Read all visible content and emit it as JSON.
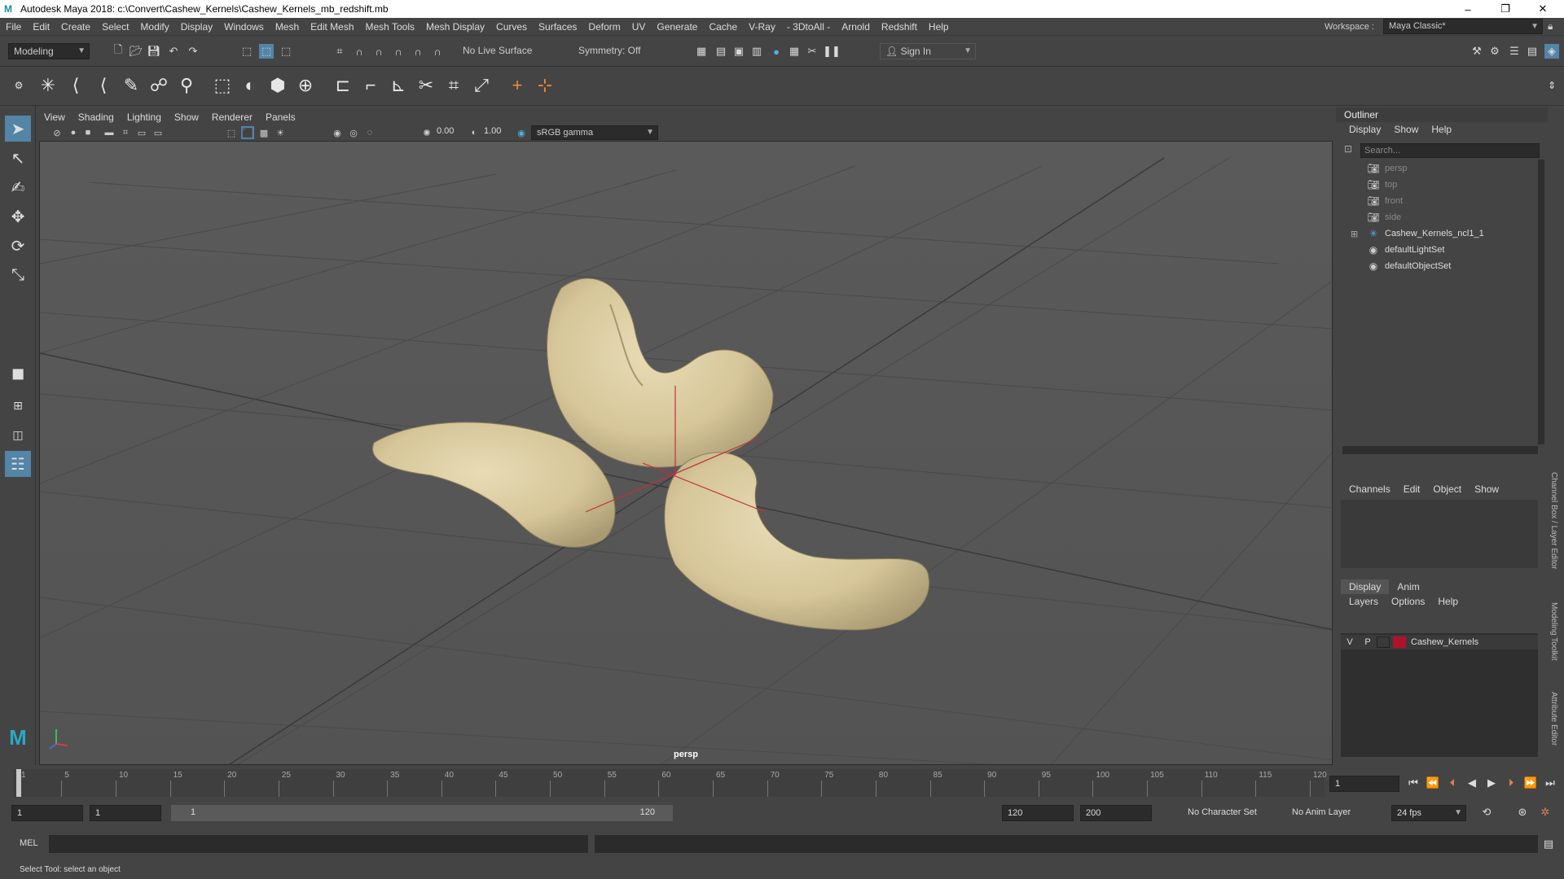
{
  "window": {
    "title": "Autodesk Maya 2018: c:\\Convert\\Cashew_Kernels\\Cashew_Kernels_mb_redshift.mb",
    "minimize": "–",
    "maximize": "❐",
    "close": "✕"
  },
  "menubar": [
    "File",
    "Edit",
    "Create",
    "Select",
    "Modify",
    "Display",
    "Windows",
    "Mesh",
    "Edit Mesh",
    "Mesh Tools",
    "Mesh Display",
    "Curves",
    "Surfaces",
    "Deform",
    "UV",
    "Generate",
    "Cache",
    "V-Ray",
    "- 3DtoAll -",
    "Arnold",
    "Redshift",
    "Help"
  ],
  "workspace": {
    "label": "Workspace :",
    "value": "Maya Classic*"
  },
  "statusline": {
    "mode": "Modeling",
    "live_surface": "No Live Surface",
    "symmetry": "Symmetry: Off",
    "sign_in": "Sign In"
  },
  "viewport": {
    "menu": [
      "View",
      "Shading",
      "Lighting",
      "Show",
      "Renderer",
      "Panels"
    ],
    "exposure": "0.00",
    "gamma": "1.00",
    "color_space": "sRGB gamma",
    "camera_label": "persp"
  },
  "outliner": {
    "title": "Outliner",
    "menu": [
      "Display",
      "Show",
      "Help"
    ],
    "search_placeholder": "Search...",
    "items": [
      {
        "label": "persp",
        "icon": "camera-icon",
        "dim": true
      },
      {
        "label": "top",
        "icon": "camera-icon",
        "dim": true
      },
      {
        "label": "front",
        "icon": "camera-icon",
        "dim": true
      },
      {
        "label": "side",
        "icon": "camera-icon",
        "dim": true
      },
      {
        "label": "Cashew_Kernels_ncl1_1",
        "icon": "group-icon",
        "dim": false
      },
      {
        "label": "defaultLightSet",
        "icon": "set-icon",
        "dim": false
      },
      {
        "label": "defaultObjectSet",
        "icon": "set-icon",
        "dim": false
      }
    ]
  },
  "channelbox": {
    "menu": [
      "Channels",
      "Edit",
      "Object",
      "Show"
    ]
  },
  "layers": {
    "tabs": [
      "Display",
      "Anim"
    ],
    "menu": [
      "Layers",
      "Options",
      "Help"
    ],
    "layer": {
      "v": "V",
      "p": "P",
      "name": "Cashew_Kernels",
      "color": "#b0122a"
    }
  },
  "sidetabs": [
    "Channel Box / Layer Editor",
    "Modeling Toolkit",
    "Attribute Editor"
  ],
  "timeslider": {
    "ticks": [
      "1",
      "5",
      "10",
      "15",
      "20",
      "25",
      "30",
      "35",
      "40",
      "45",
      "50",
      "55",
      "60",
      "65",
      "70",
      "75",
      "80",
      "85",
      "90",
      "95",
      "100",
      "105",
      "110",
      "115",
      "120"
    ],
    "current_frame": "1"
  },
  "range": {
    "start": "1",
    "playback_start": "1",
    "slider_start": "1",
    "slider_end": "120",
    "playback_end": "120",
    "end": "200",
    "character_set": "No Character Set",
    "anim_layer": "No Anim Layer",
    "fps": "24 fps"
  },
  "cmdline": {
    "label": "MEL"
  },
  "helpline": {
    "text": "Select Tool: select an object"
  }
}
